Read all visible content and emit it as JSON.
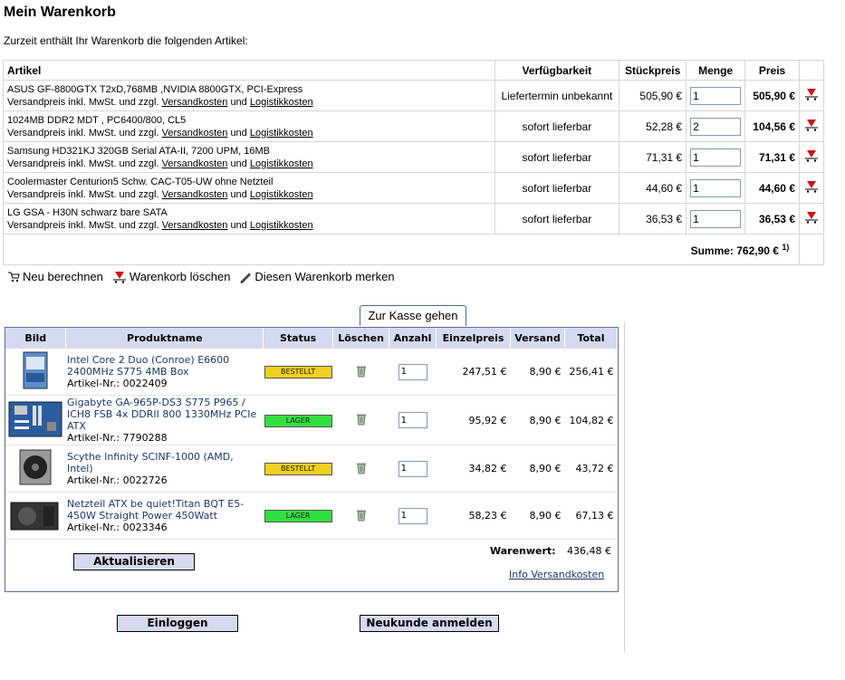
{
  "title": "Mein Warenkorb",
  "intro": "Zurzeit enthält Ihr Warenkorb die folgenden Artikel:",
  "cart": {
    "headers": [
      "Artikel",
      "Verfügbarkeit",
      "Stückpreis",
      "Menge",
      "Preis"
    ],
    "ship_prefix": "Versandpreis inkl. MwSt. und zzgl.",
    "ship_link": "Versandkosten",
    "ship_and": "und",
    "logistic_link": "Logistikkosten",
    "items": [
      {
        "name": "ASUS GF-8800GTX T2xD,768MB ,NVIDIA 8800GTX, PCI-Express",
        "availability": "Liefertermin unbekannt",
        "unit": "505,90 €",
        "qty": "1",
        "total": "505,90 €"
      },
      {
        "name": "1024MB DDR2 MDT , PC6400/800, CL5",
        "availability": "sofort lieferbar",
        "unit": "52,28 €",
        "qty": "2",
        "total": "104,56 €"
      },
      {
        "name": "Samsung HD321KJ 320GB Serial ATA-II, 7200 UPM, 16MB",
        "availability": "sofort lieferbar",
        "unit": "71,31 €",
        "qty": "1",
        "total": "71,31 €"
      },
      {
        "name": "Coolermaster Centurion5 Schw. CAC-T05-UW ohne Netzteil",
        "availability": "sofort lieferbar",
        "unit": "44,60 €",
        "qty": "1",
        "total": "44,60 €"
      },
      {
        "name": "LG GSA - H30N schwarz bare SATA",
        "availability": "sofort lieferbar",
        "unit": "36,53 €",
        "qty": "1",
        "total": "36,53 €"
      }
    ],
    "sum_label": "Summe: 762,90 €",
    "sum_note": "1)"
  },
  "actions": {
    "recalc": "Neu berechnen",
    "clear": "Warenkorb löschen",
    "remember": "Diesen Warenkorb merken"
  },
  "checkout": "Zur Kasse gehen",
  "shop": {
    "headers": [
      "Bild",
      "Produktname",
      "Status",
      "Löschen",
      "Anzahl",
      "Einzelpreis",
      "Versand",
      "Total"
    ],
    "items": [
      {
        "name": "Intel Core 2 Duo (Conroe) E6600 2400MHz S775 4MB Box",
        "artnr": "Artikel-Nr.: 0022409",
        "status": "BESTELLT",
        "status_color": "#f0d020",
        "qty": "1",
        "unit": "247,51 €",
        "ship": "8,90 €",
        "total": "256,41 €",
        "image": "cpu-box"
      },
      {
        "name": "Gigabyte GA-965P-DS3 S775 P965 / ICH8 FSB 4x DDRII 800 1330MHz PCIe ATX",
        "artnr": "Artikel-Nr.: 7790288",
        "status": "LAGER",
        "status_color": "#30e040",
        "qty": "1",
        "unit": "95,92 €",
        "ship": "8,90 €",
        "total": "104,82 €",
        "image": "mainboard"
      },
      {
        "name": "Scythe Infinity SCINF-1000 (AMD, Intel)",
        "artnr": "Artikel-Nr.: 0022726",
        "status": "BESTELLT",
        "status_color": "#f0d020",
        "qty": "1",
        "unit": "34,82 €",
        "ship": "8,90 €",
        "total": "43,72 €",
        "image": "cooler"
      },
      {
        "name": "Netzteil ATX be quiet!Titan BQT E5-450W Straight Power 450Watt",
        "artnr": "Artikel-Nr.: 0023346",
        "status": "LAGER",
        "status_color": "#30e040",
        "qty": "1",
        "unit": "58,23 €",
        "ship": "8,90 €",
        "total": "67,13 €",
        "image": "psu"
      }
    ],
    "warenwert_label": "Warenwert:",
    "warenwert_value": "436,48 €",
    "update": "Aktualisieren",
    "info": "Info Versandkosten"
  },
  "login": "Einloggen",
  "register": "Neukunde anmelden"
}
